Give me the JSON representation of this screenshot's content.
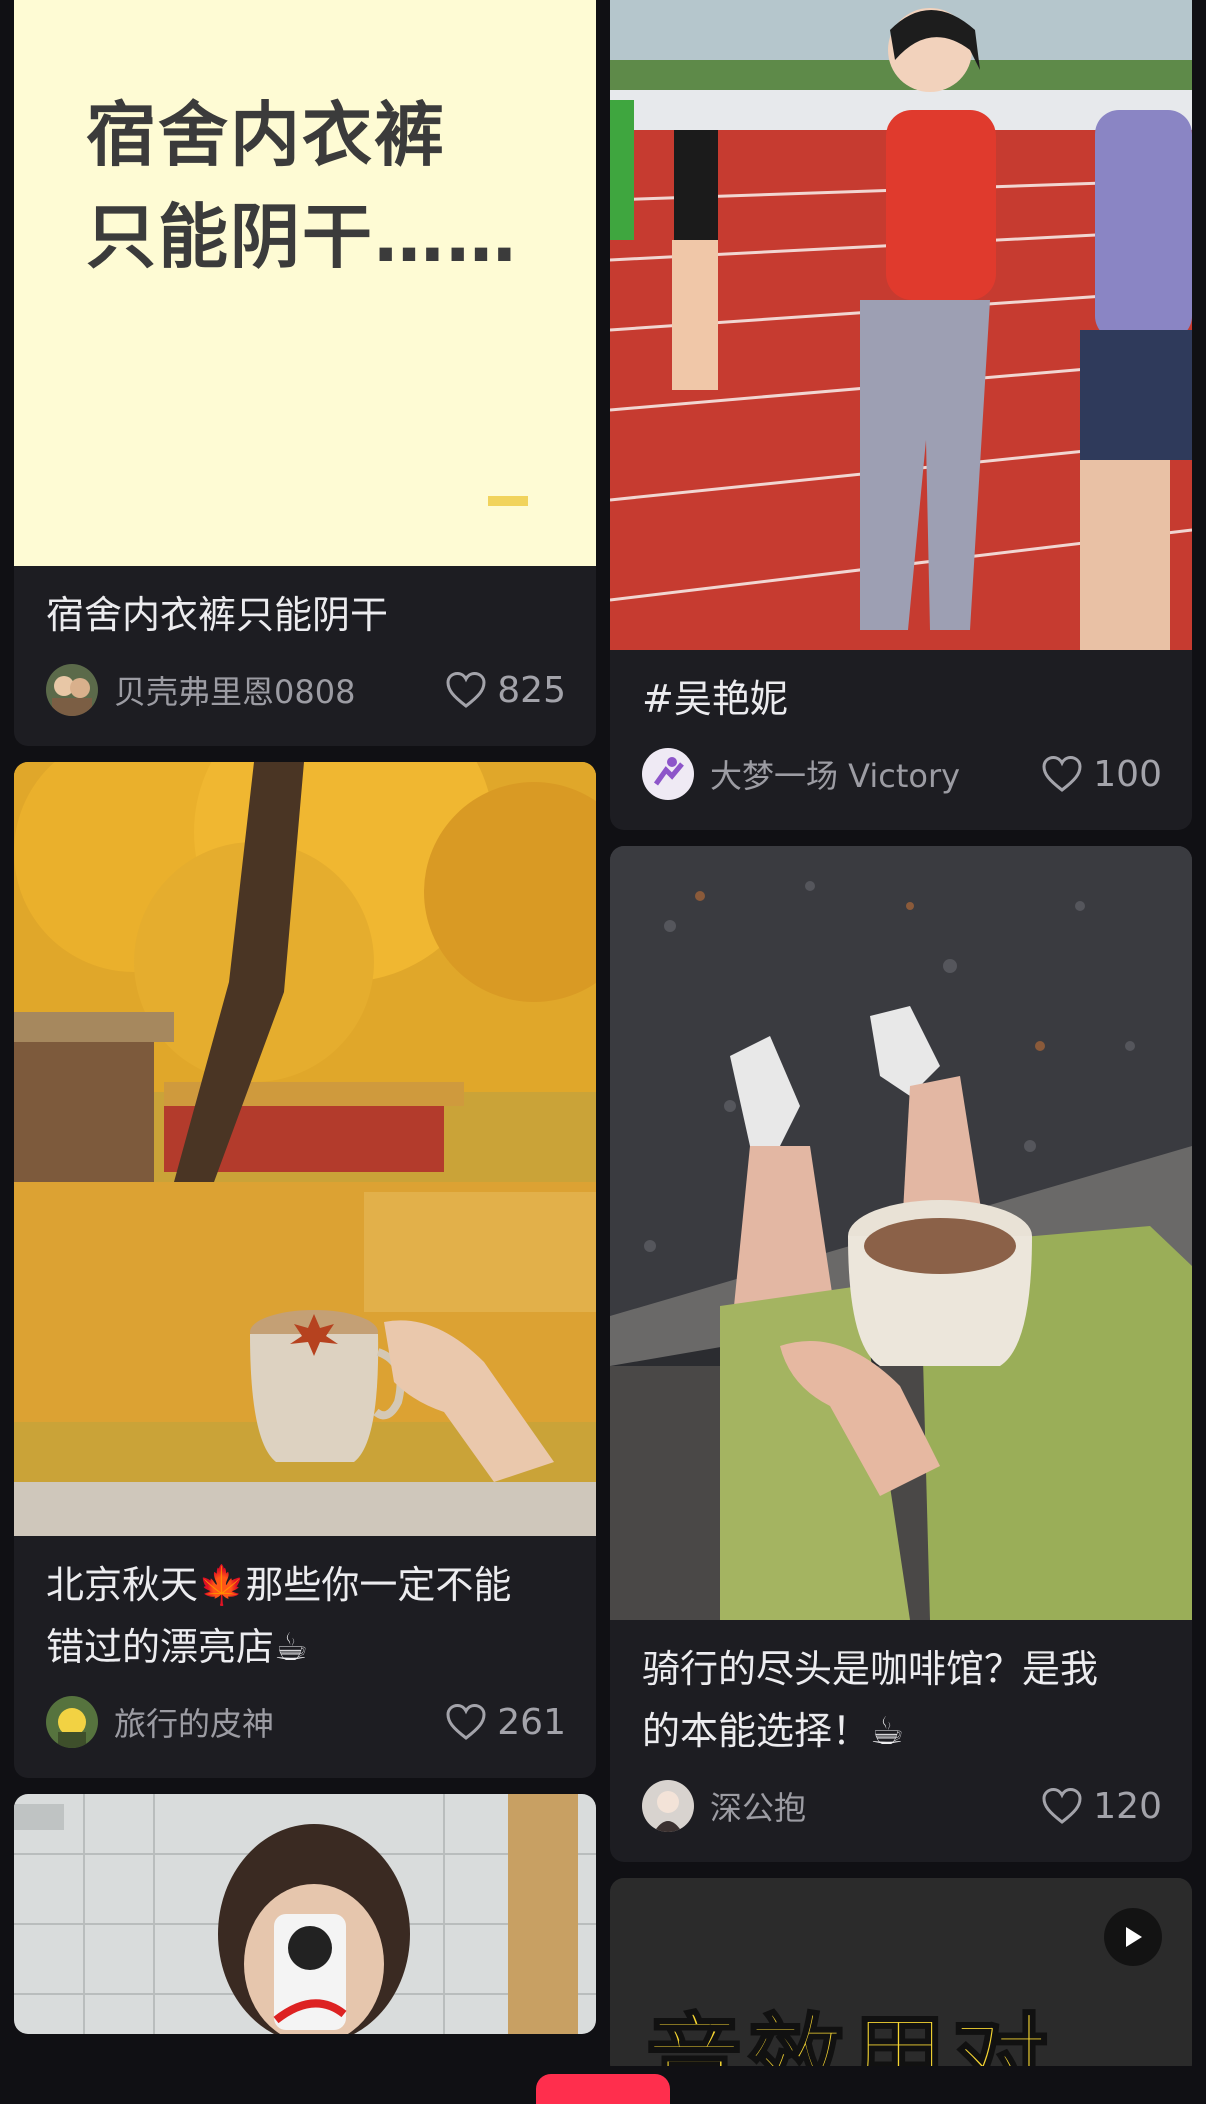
{
  "left_column": [
    {
      "cover_text": [
        "宿舍内衣裤",
        "只能阴干……"
      ],
      "title": "宿舍内衣裤只能阴干",
      "author": "贝壳弗里恩0808",
      "likes": "825"
    },
    {
      "title_line1": "北京秋天",
      "title_emoji1": "🍁",
      "title_rest1": "那些你一定不能",
      "title_line2": "错过的漂亮店",
      "title_emoji2": "☕",
      "author": "旅行的皮神",
      "likes": "261"
    },
    {}
  ],
  "right_column": [
    {
      "title": "#吴艳妮",
      "author": "大梦一场 Victory",
      "likes": "100"
    },
    {
      "title_line1": "骑行的尽头是咖啡馆？是我",
      "title_line2": "的本能选择！",
      "title_emoji": "☕",
      "author": "深公抱",
      "likes": "120"
    },
    {
      "cover_text": "音效用对",
      "has_play": true
    }
  ],
  "colors": {
    "background": "#101014",
    "card": "#1d1d22",
    "accent": "#ff2e4d"
  }
}
